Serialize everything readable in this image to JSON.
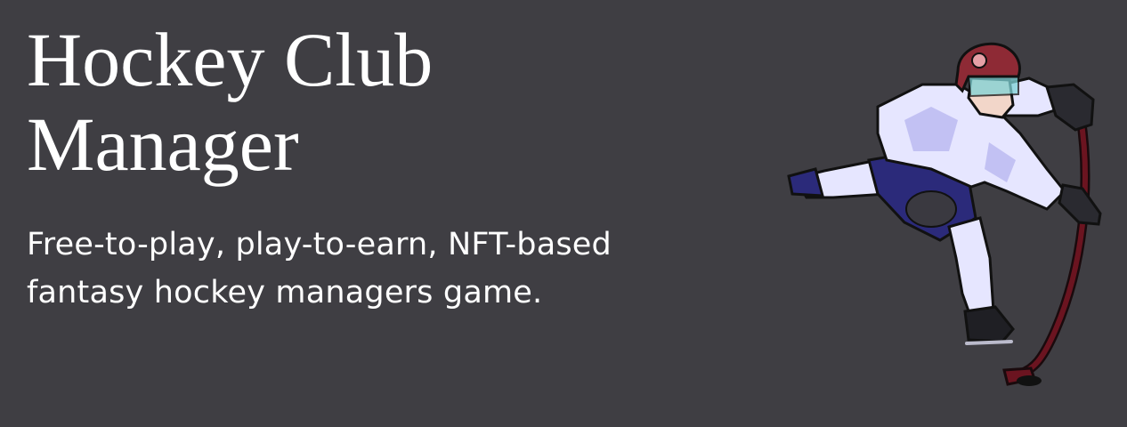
{
  "hero": {
    "title_line_1": "Hockey Club",
    "title_line_2": "Manager",
    "subtitle_line_1": "Free-to-play, play-to-earn, NFT-based",
    "subtitle_line_2": "fantasy hockey managers game."
  },
  "colors": {
    "background": "#3f3e43",
    "text": "#ffffff",
    "jersey": "#e6e6ff",
    "jersey_shade": "#b9b8f0",
    "pants": "#2b2a7a",
    "helmet": "#8e2a35",
    "visor": "#7fd3d6",
    "stick": "#6b1420"
  },
  "illustration": {
    "icon": "hockey-player-icon"
  }
}
